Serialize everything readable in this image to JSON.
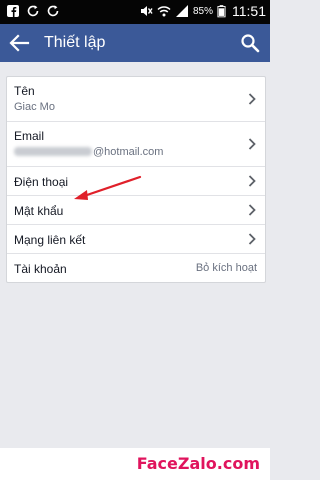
{
  "status_bar": {
    "icons_left": [
      "facebook-icon",
      "sync-icon",
      "sync-icon"
    ],
    "icons_right": [
      "mute-icon",
      "wifi-icon",
      "signal-icon",
      "battery-icon"
    ],
    "battery": "85%",
    "time": "11:51"
  },
  "app_bar": {
    "title": "Thiết lập",
    "background": "#3b5998",
    "back_icon": "arrow-left-icon",
    "search_icon": "search-icon"
  },
  "settings": [
    {
      "label": "Tên",
      "value": "Giac Mo"
    },
    {
      "label": "Email",
      "value_visible": "@hotmail.com"
    },
    {
      "label": "Điện thoại"
    },
    {
      "label": "Mật khẩu"
    },
    {
      "label": "Mạng liên kết"
    },
    {
      "label": "Tài khoản",
      "action": "Bỏ kích hoạt"
    }
  ],
  "annotation": {
    "color": "#e0202a"
  },
  "watermark": {
    "text": "FaceZalo.com",
    "color": "#e0145d"
  }
}
